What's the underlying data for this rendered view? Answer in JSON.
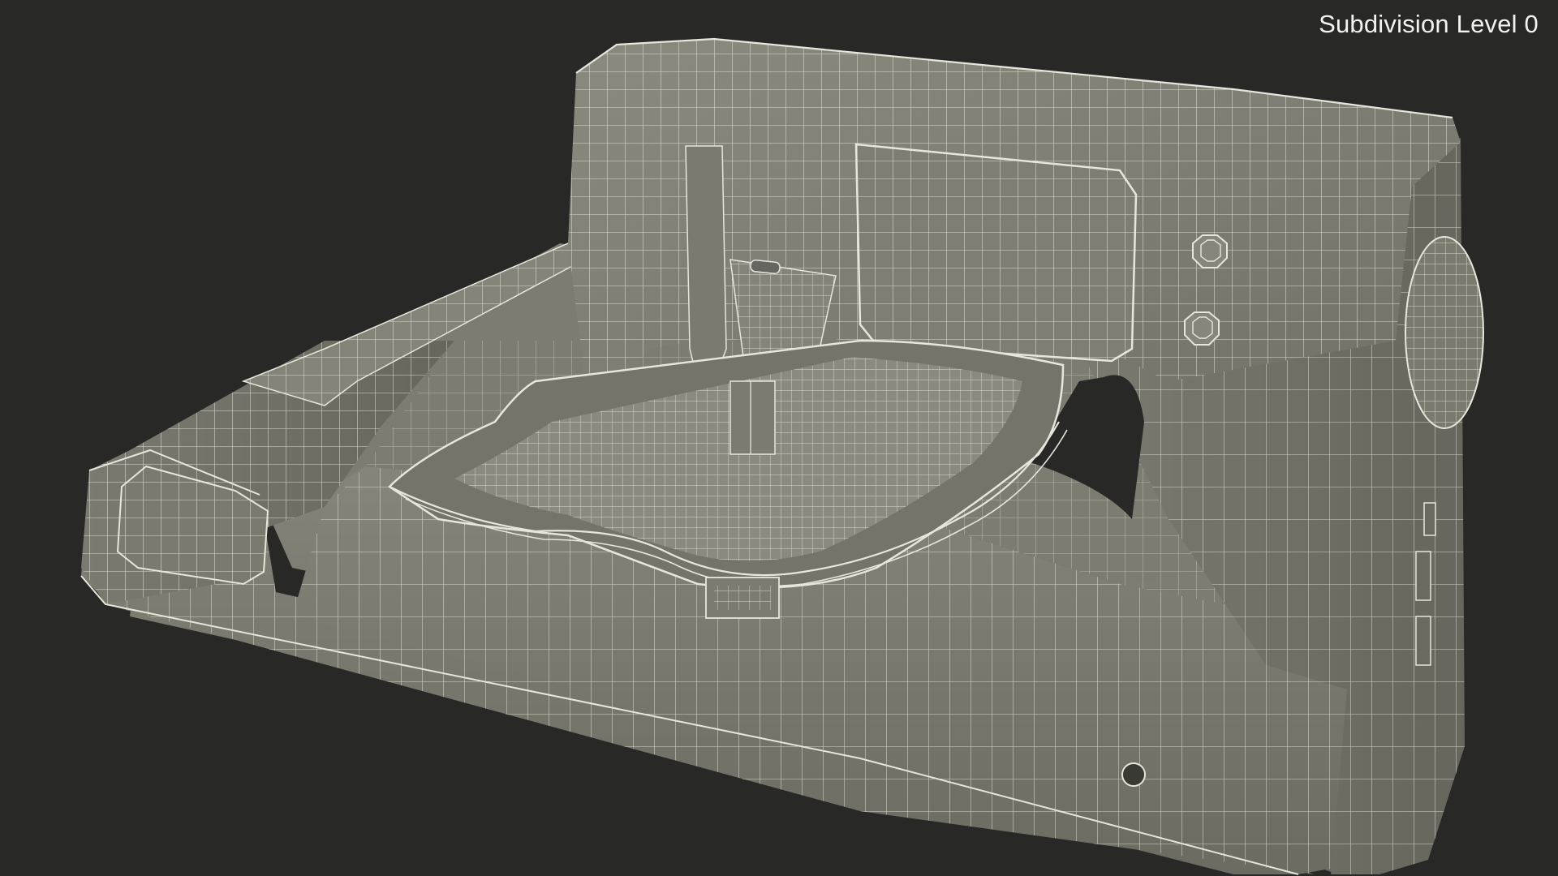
{
  "viewport": {
    "overlay_label": "Subdivision Level 0",
    "background_color": "#282826",
    "model_fill_color": "#7d7d72",
    "wire_color": "#e6e6dc"
  },
  "model": {
    "subject": "embroidery-sewing-machine-wireframe"
  }
}
